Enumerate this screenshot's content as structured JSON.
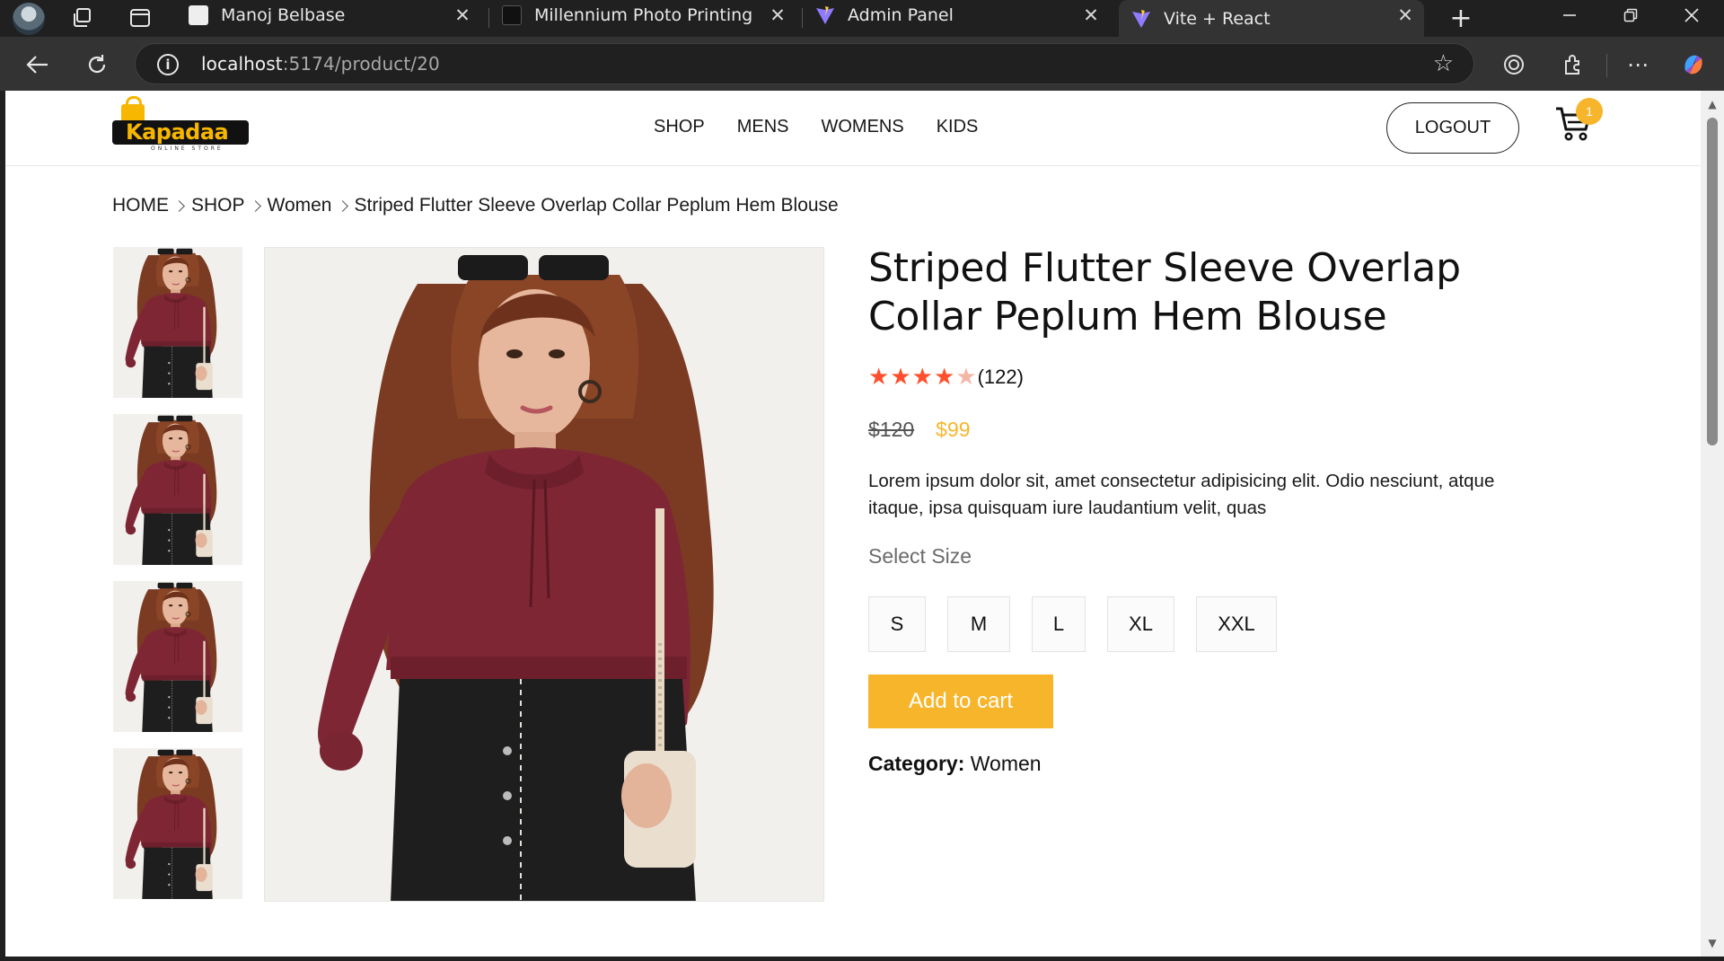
{
  "browser": {
    "tabs": [
      {
        "title": "Manoj Belbase",
        "active": false
      },
      {
        "title": "Millennium Photo Printing",
        "active": false
      },
      {
        "title": "Admin Panel",
        "active": false
      },
      {
        "title": "Vite + React",
        "active": true
      }
    ],
    "url_host": "localhost",
    "url_path": ":5174/product/20"
  },
  "site": {
    "logo_text": "Kapadaa",
    "logo_subtitle": "ONLINE STORE",
    "menu": [
      "SHOP",
      "MENS",
      "WOMENS",
      "KIDS"
    ],
    "logout_label": "LOGOUT",
    "cart_count": "1"
  },
  "breadcrumb": [
    "HOME",
    "SHOP",
    "Women",
    "Striped Flutter Sleeve Overlap Collar Peplum Hem Blouse"
  ],
  "product": {
    "title": "Striped Flutter Sleeve Overlap Collar Peplum Hem Blouse",
    "rating_stars": 4,
    "rating_max": 5,
    "review_count": "(122)",
    "old_price": "$120",
    "new_price": "$99",
    "description": "Lorem ipsum dolor sit, amet consectetur adipisicing elit. Odio nesciunt, atque itaque, ipsa quisquam iure laudantium velit, quas",
    "size_label": "Select Size",
    "sizes": [
      "S",
      "M",
      "L",
      "XL",
      "XXL"
    ],
    "add_to_cart_label": "Add to cart",
    "category_label": "Category:",
    "category_value": "Women"
  },
  "colors": {
    "accent": "#f7b52b",
    "star": "#ff4f2e",
    "blouse": "#7f2635"
  }
}
